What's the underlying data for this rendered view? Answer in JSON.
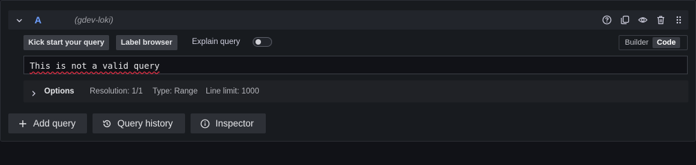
{
  "query": {
    "ref_id": "A",
    "datasource": "(gdev-loki)",
    "header_icons": [
      "help-icon",
      "duplicate-icon",
      "eye-icon",
      "trash-icon",
      "drag-handle-icon"
    ]
  },
  "toolbar": {
    "kick_start": "Kick start your query",
    "label_browser": "Label browser",
    "explain_query": "Explain query",
    "explain_enabled": false,
    "modes": [
      "Builder",
      "Code"
    ],
    "active_mode": "Code"
  },
  "editor": {
    "value": "This is not a valid query"
  },
  "options": {
    "title": "Options",
    "resolution": "Resolution: 1/1",
    "type": "Type: Range",
    "line_limit": "Line limit: 1000"
  },
  "actions": {
    "add_query": "Add query",
    "query_history": "Query history",
    "inspector": "Inspector"
  },
  "colors": {
    "ref_id": "#6e9fff",
    "error_underline": "#e02f44"
  }
}
